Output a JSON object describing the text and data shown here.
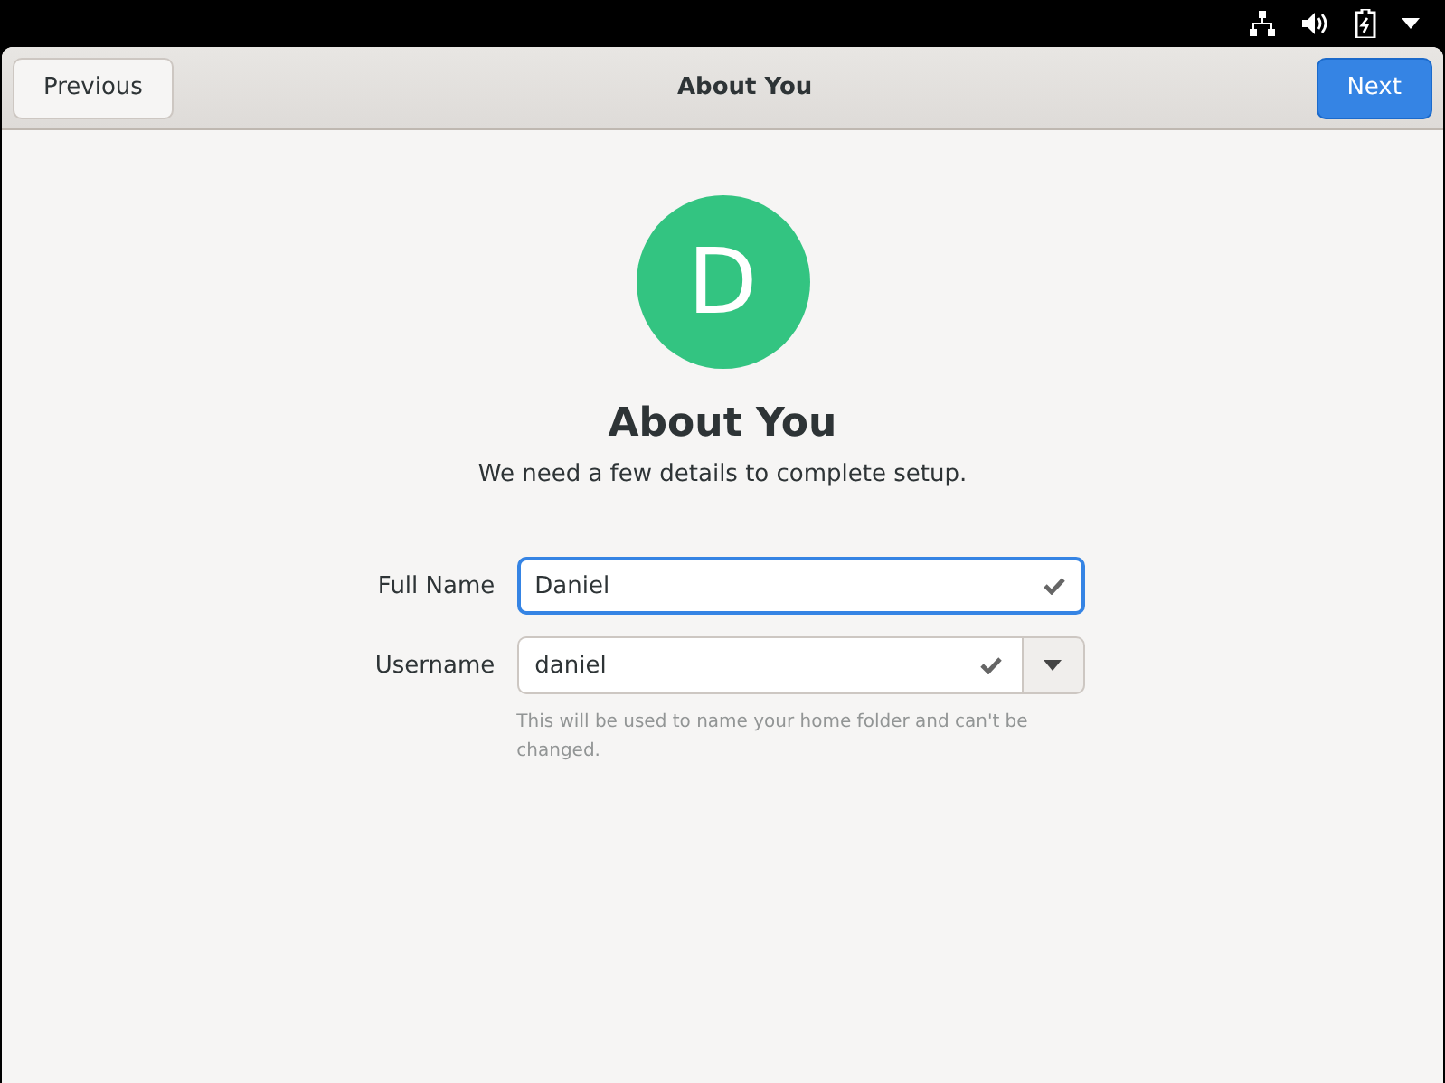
{
  "header": {
    "title": "About You",
    "previous_button": "Previous",
    "next_button": "Next"
  },
  "avatar": {
    "initial": "D"
  },
  "heading": "About You",
  "subtitle": "We need a few details to complete setup.",
  "fields": [
    {
      "kind": "text",
      "label": "Full Name",
      "value": "Daniel",
      "focused": true,
      "valid": true
    },
    {
      "kind": "combo",
      "label": "Username",
      "value": "daniel",
      "focused": false,
      "valid": true,
      "hint": "This will be used to name your home folder and can't be changed."
    }
  ]
}
